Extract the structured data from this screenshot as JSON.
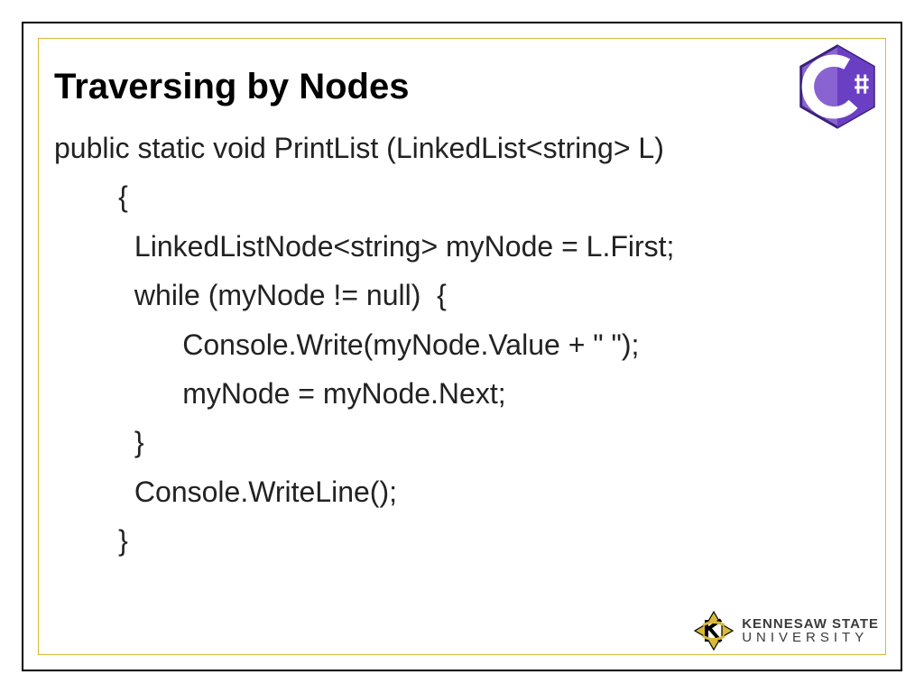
{
  "title": "Traversing by Nodes",
  "code": {
    "l1": "public static void PrintList (LinkedList<string> L)",
    "l2": "        {",
    "l3": "          LinkedListNode<string> myNode = L.First;",
    "l4": "          while (myNode != null)  {",
    "l5": "                Console.Write(myNode.Value + \" \");",
    "l6": "                myNode = myNode.Next;",
    "l7": "          }",
    "l8": "          Console.WriteLine();",
    "l9": "        }"
  },
  "badge": {
    "label": "C#"
  },
  "footer_logo": {
    "line1": "KENNESAW STATE",
    "line2": "UNIVERSITY"
  }
}
